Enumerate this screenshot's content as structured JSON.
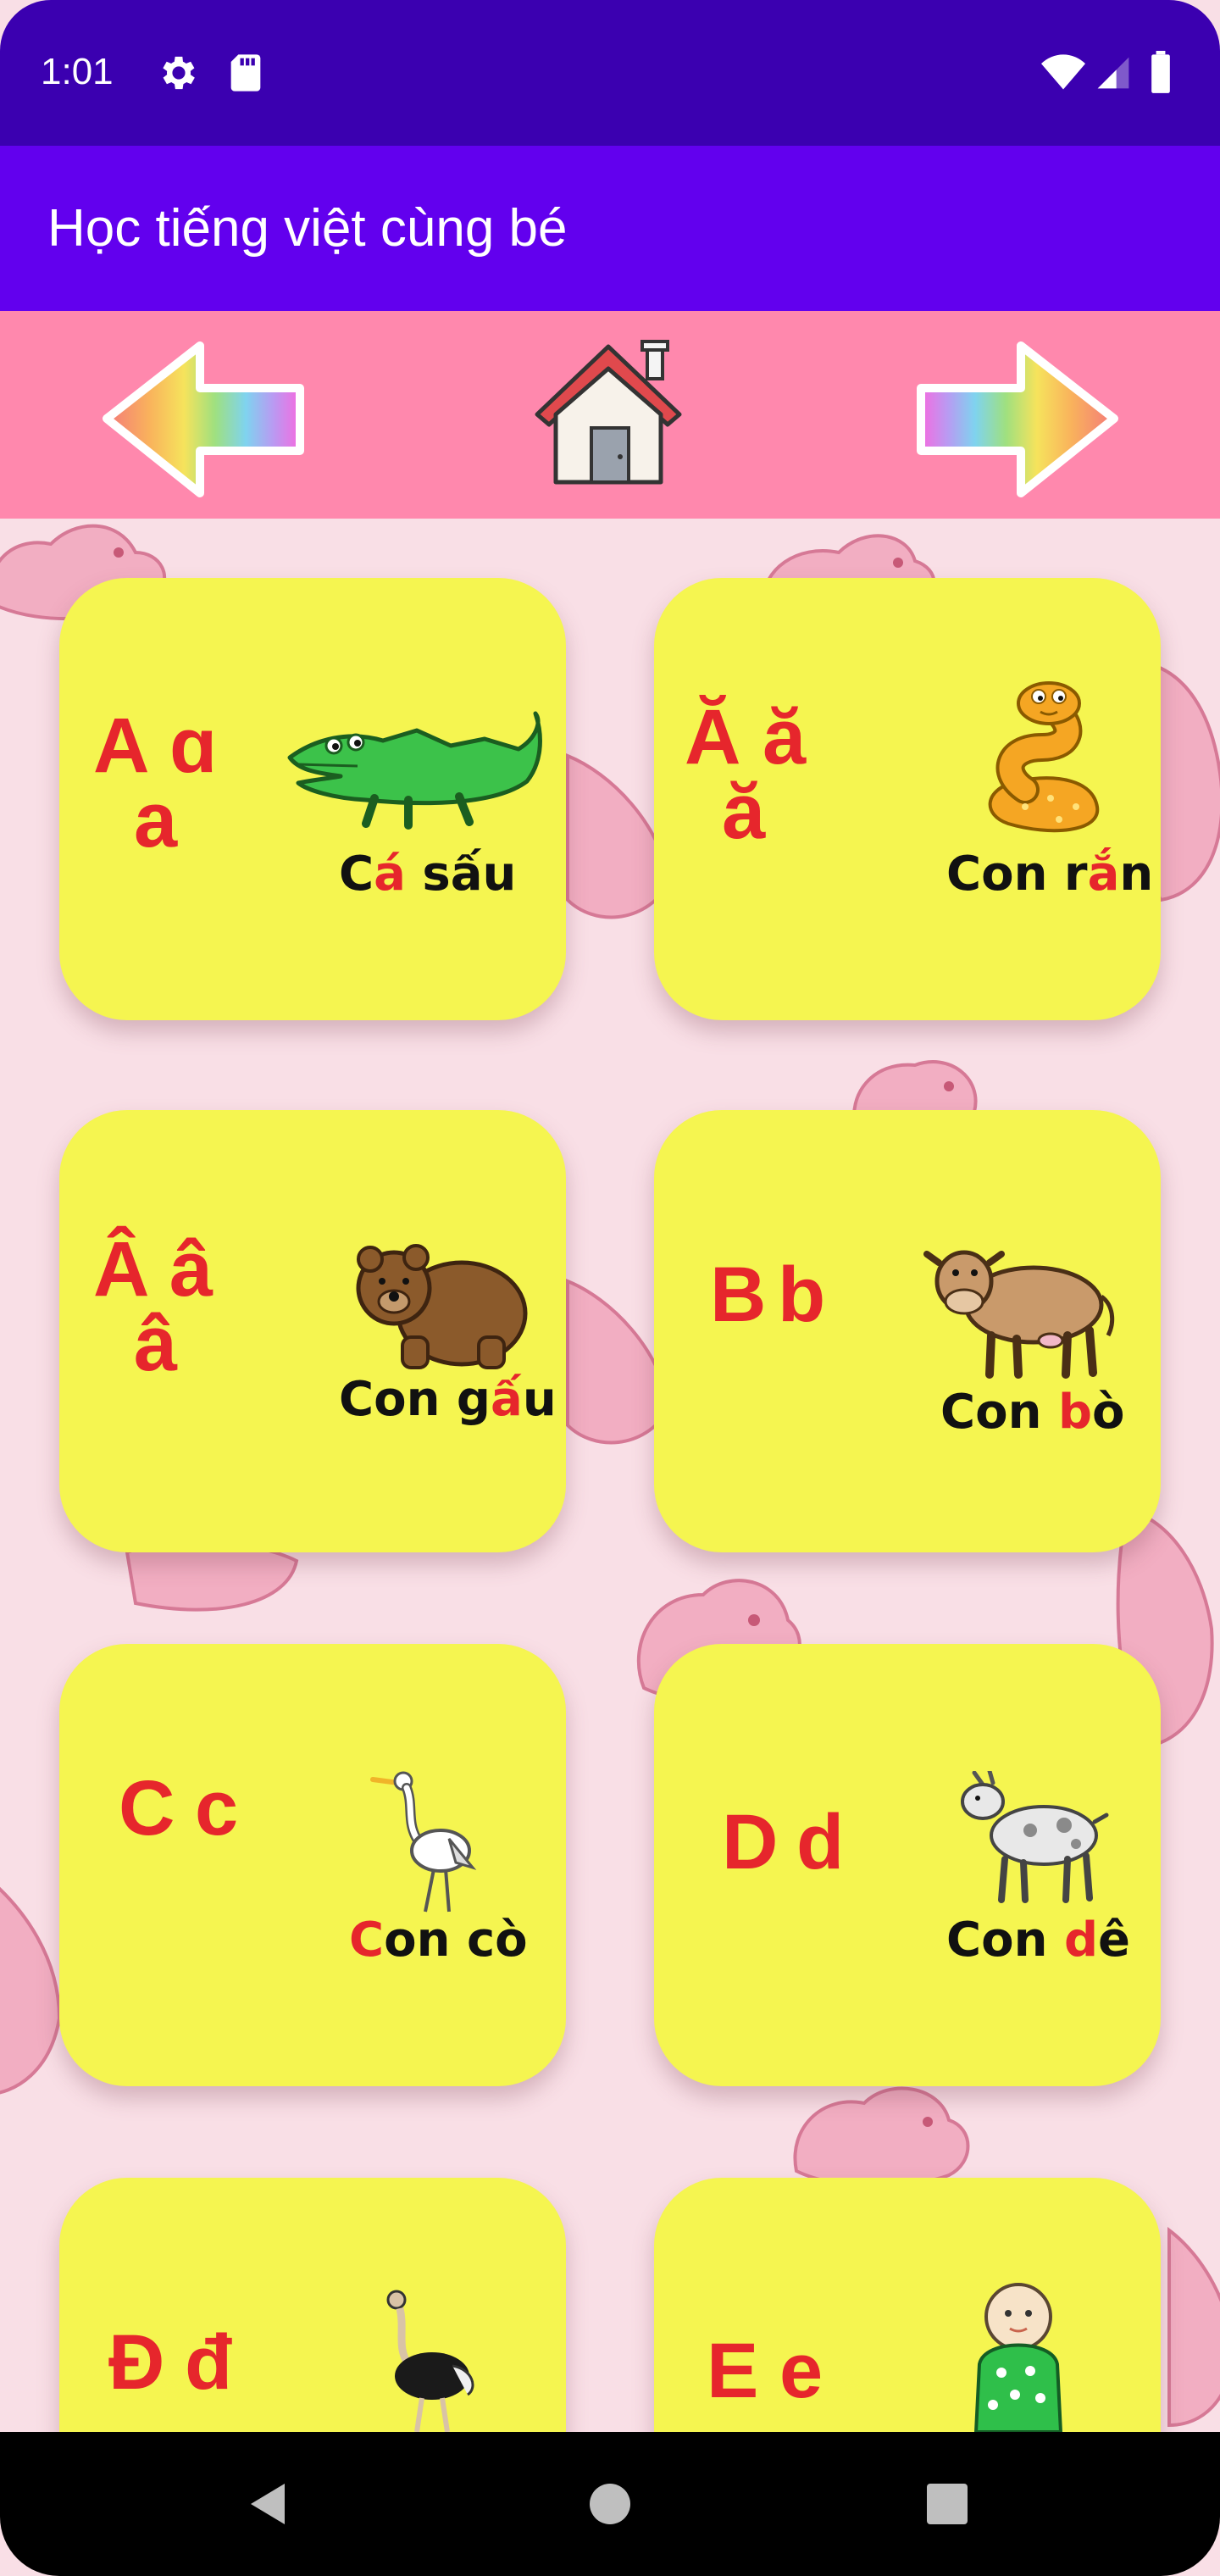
{
  "status_bar": {
    "time": "1:01",
    "icons": [
      "gear-icon",
      "sd-card-icon",
      "wifi-icon",
      "signal-icon",
      "battery-icon"
    ]
  },
  "app_bar": {
    "title": "Học tiếng việt cùng bé",
    "color": "#6200ee"
  },
  "nav_bar": {
    "color": "#ff88ad",
    "buttons": [
      "rainbow-arrow-left-icon",
      "house-icon",
      "rainbow-arrow-right-icon"
    ]
  },
  "cards": [
    {
      "letter_upper": "A",
      "letter_lower": "ɑ",
      "letter_extra": "a",
      "word_pre": "C",
      "word_hl": "á",
      "word_post": " sấu",
      "picture": "crocodile-icon"
    },
    {
      "letter_upper": "Ă",
      "letter_lower": "ă",
      "letter_extra": "ă",
      "word_pre": "Con r",
      "word_hl": "ắ",
      "word_post": "n",
      "picture": "snake-icon"
    },
    {
      "letter_upper": "Â",
      "letter_lower": "â",
      "letter_extra": "â",
      "word_pre": "Con g",
      "word_hl": "ấ",
      "word_post": "u",
      "picture": "bear-icon"
    },
    {
      "letter_upper": "B",
      "letter_lower": "b",
      "letter_extra": "",
      "word_pre": "Con ",
      "word_hl": "b",
      "word_post": "ò",
      "picture": "cow-icon"
    },
    {
      "letter_upper": "C",
      "letter_lower": "c",
      "letter_extra": "",
      "word_pre": "",
      "word_hl": "C",
      "word_post": "on cò",
      "picture": "stork-icon"
    },
    {
      "letter_upper": "D",
      "letter_lower": "d",
      "letter_extra": "",
      "word_pre": "Con ",
      "word_hl": "d",
      "word_post": "ê",
      "picture": "goat-icon"
    },
    {
      "letter_upper": "Đ",
      "letter_lower": "đ",
      "letter_extra": "",
      "word_pre": "",
      "word_hl": "",
      "word_post": "",
      "picture": "ostrich-icon"
    },
    {
      "letter_upper": "E",
      "letter_lower": "e",
      "letter_extra": "",
      "word_pre": "",
      "word_hl": "",
      "word_post": "",
      "picture": "baby-icon"
    }
  ],
  "system_nav": {
    "buttons": [
      "back-icon",
      "home-circle-icon",
      "recents-icon"
    ]
  }
}
